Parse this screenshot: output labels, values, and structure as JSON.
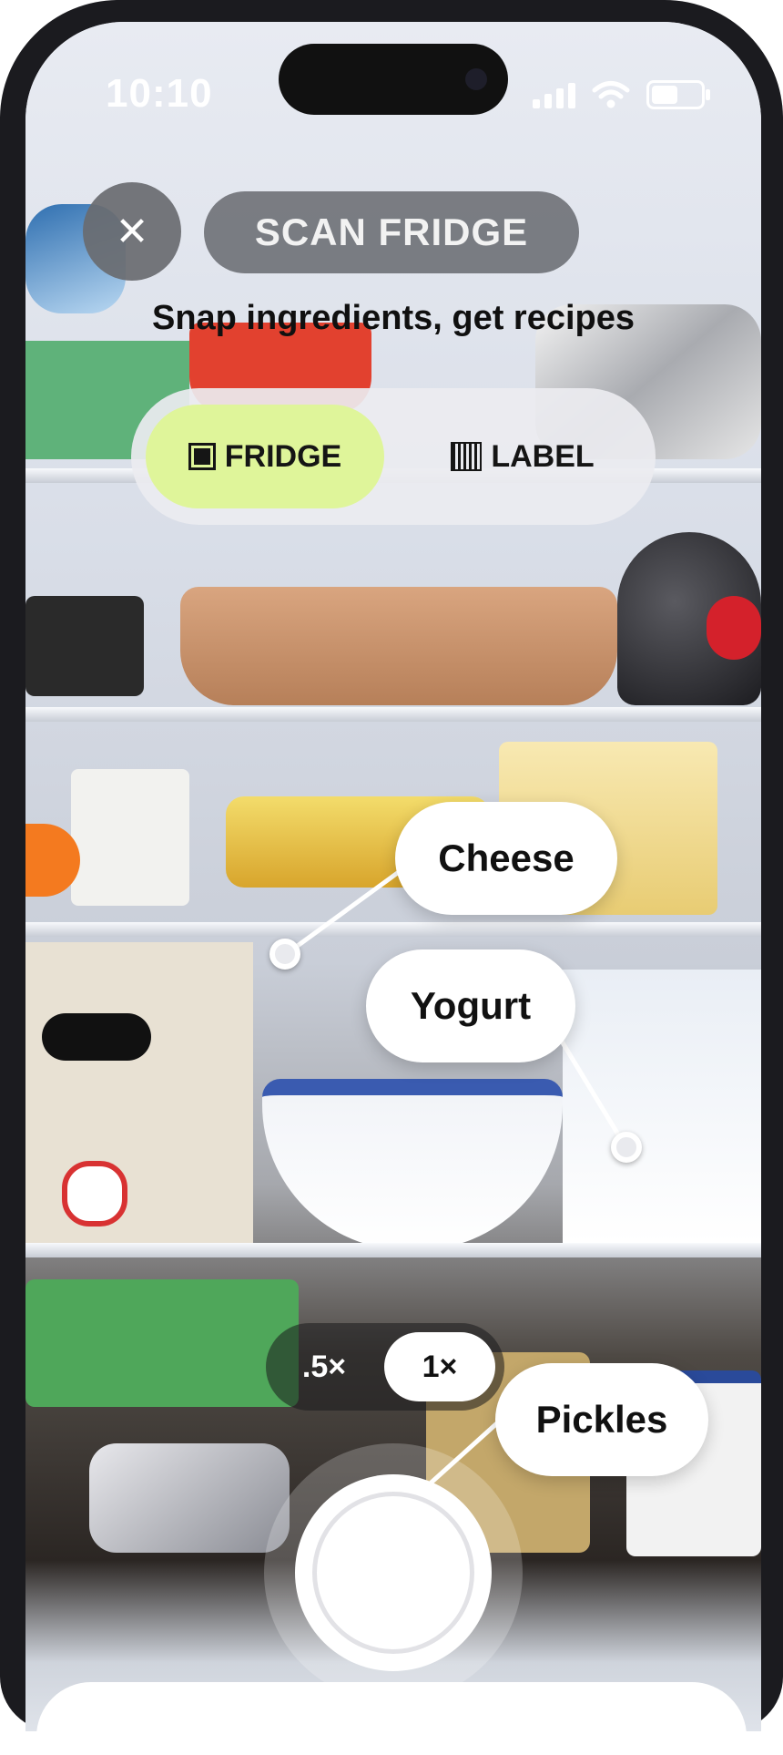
{
  "status_bar": {
    "time": "10:10"
  },
  "header": {
    "close_icon": "close-icon",
    "title": "SCAN FRIDGE",
    "subtitle": "Snap ingredients, get recipes"
  },
  "mode_toggle": {
    "options": [
      {
        "label": "FRIDGE",
        "icon": "square-icon",
        "selected": true
      },
      {
        "label": "LABEL",
        "icon": "barcode-icon",
        "selected": false
      }
    ]
  },
  "detections": [
    {
      "label": "Cheese"
    },
    {
      "label": "Yogurt"
    },
    {
      "label": "Pickles"
    }
  ],
  "zoom": {
    "options": [
      ".5×",
      "1×"
    ],
    "selected": "1×"
  },
  "colors": {
    "accent": "#dff59a",
    "pill_gray": "#6e7076",
    "tag_bg": "#ffffff"
  }
}
